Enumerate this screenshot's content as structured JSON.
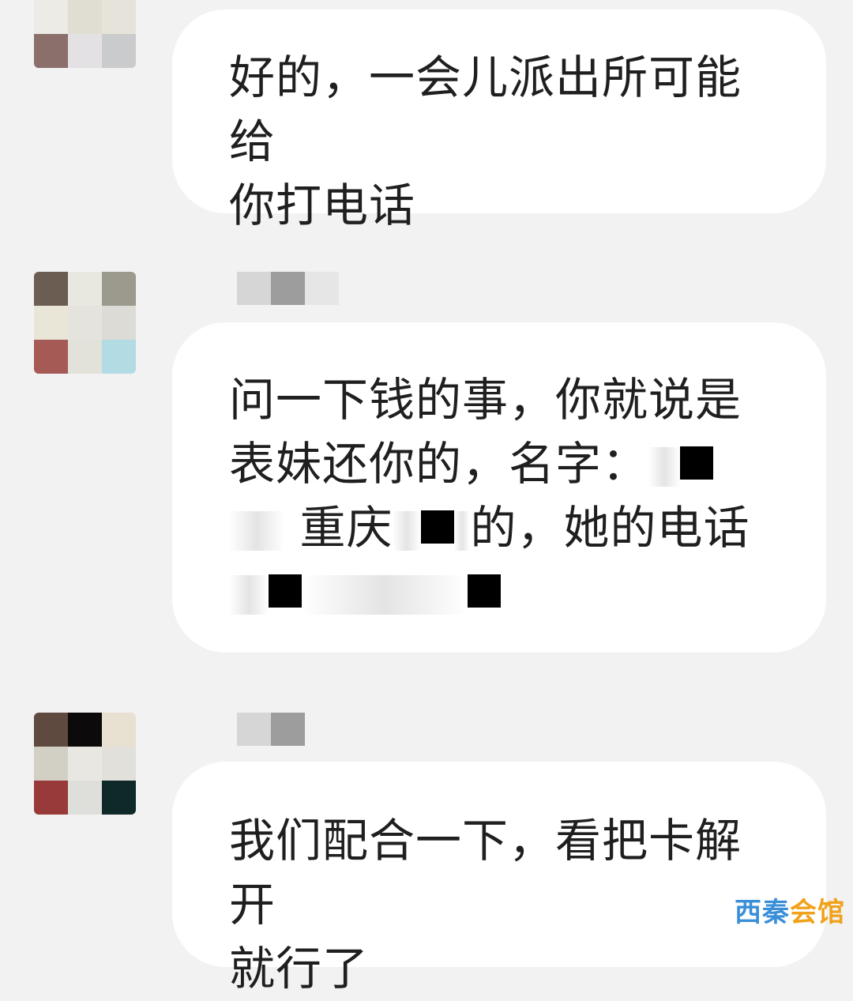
{
  "messages": [
    {
      "line1": "好的，一会儿派出所可能给",
      "line2": "你打电话"
    },
    {
      "line1": "问一下钱的事，你就说是",
      "line2_pre": "表妹还你的，名字：",
      "line3_a": "重庆",
      "line3_b": "的，她的电话"
    },
    {
      "line1": "我们配合一下，看把卡解开",
      "line2": "就行了"
    }
  ],
  "watermark": {
    "part1": "西秦",
    "part2": "会馆"
  },
  "colors": {
    "background": "#f2f2f2",
    "bubble": "#ffffff",
    "text": "#1f1f1f"
  }
}
